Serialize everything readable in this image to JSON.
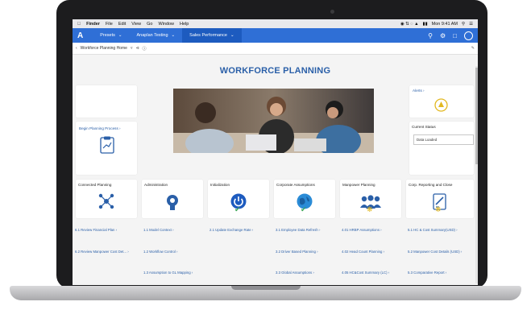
{
  "mac_menubar": {
    "app": "Finder",
    "menus": [
      "File",
      "Edit",
      "View",
      "Go",
      "Window",
      "Help"
    ],
    "datetime": "Mon 9:41 AM"
  },
  "app_nav": {
    "logo": "A",
    "tabs": [
      "Presets",
      "Anaplan Testing",
      "Sales Performance"
    ]
  },
  "page_header": {
    "breadcrumb": "Workforce Planning Home"
  },
  "page_title": "WORKFORCE PLANNING",
  "tiles": {
    "begin": "Begin Planning Process",
    "alerts": "Alerts",
    "current_status_label": "Current Status",
    "current_status_value": "Data Loaded",
    "connected": "Connected Planning",
    "administration": "Administration",
    "initialization": "Initialization",
    "corporate": "Corporate Assumptions",
    "manpower": "Manpower Planning",
    "corp_reporting": "Corp. Reporting and Close"
  },
  "links": {
    "col1": [
      "6.1 Review Financial Plan",
      "6.2 Review Manpower Cost Det..."
    ],
    "col2": [
      "1.1 Model Context",
      "1.2 Workflow Control",
      "1.3 Assumption to GL Mapping"
    ],
    "col3": [
      "2.1 Update Exchange Rate"
    ],
    "col4": [
      "3.1 Employee Data Refresh",
      "3.2 Driver Based Planning",
      "3.3 Global Assumptions"
    ],
    "col5": [
      "4.01 HRBP Assumptions",
      "4.02 Head Count Planning",
      "4.05 HC&Cost Summary (LC)"
    ],
    "col6": [
      "5.1 HC & Cost Summary(USD)",
      "5.2 Manpower Cost Details (USD)",
      "5.3 Comparative Report"
    ]
  }
}
